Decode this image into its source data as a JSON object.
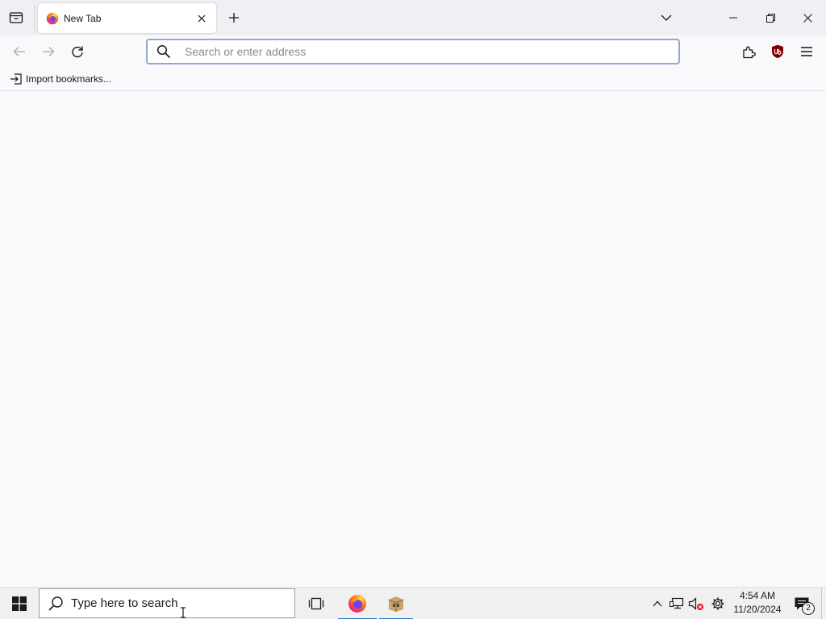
{
  "browser": {
    "tab": {
      "title": "New Tab"
    },
    "urlbar": {
      "placeholder": "Search or enter address",
      "value": ""
    },
    "bookmarks_bar": {
      "import_label": "Import bookmarks..."
    },
    "icons": {
      "tab_list": "firefox-view-icon",
      "favicon": "firefox-icon",
      "tab_close": "close-icon",
      "new_tab": "plus-icon",
      "list_all_tabs": "chevron-down-icon",
      "back": "back-arrow-icon",
      "forward": "forward-arrow-icon",
      "reload": "reload-icon",
      "extensions": "puzzle-icon",
      "ublock": "ublock-origin-icon",
      "menu": "hamburger-menu-icon"
    },
    "colors": {
      "urlbar_border": "#93a8d0",
      "ublock": "#800000"
    }
  },
  "taskbar": {
    "search_placeholder": "Type here to search",
    "clock": {
      "time": "4:54 AM",
      "date": "11/20/2024"
    },
    "notifications_count": "2",
    "apps": [
      {
        "name": "Firefox",
        "icon": "firefox-icon",
        "active": true
      },
      {
        "name": "Package",
        "icon": "package-icon",
        "active": true
      }
    ],
    "colors": {
      "active_underline": "#2f79c8"
    }
  }
}
